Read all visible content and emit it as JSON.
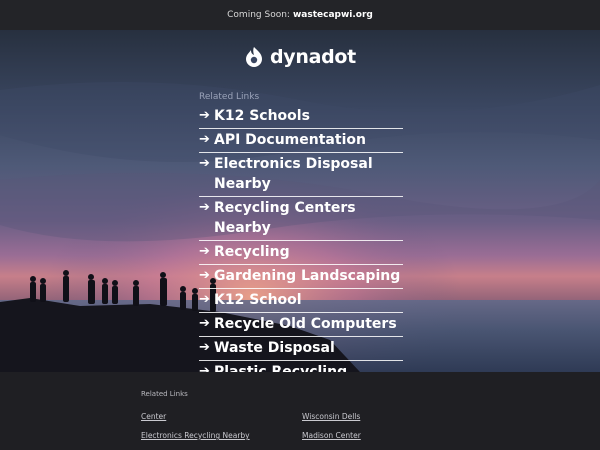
{
  "top_bar": {
    "prefix": "Coming Soon:",
    "domain": "wastecapwi.org"
  },
  "logo": {
    "text": "dynadot",
    "icon": "dynadot-flame-logo"
  },
  "related_links": {
    "heading": "Related Links",
    "arrow": "➔",
    "items": [
      {
        "label": "K12 Schools"
      },
      {
        "label": "API Documentation"
      },
      {
        "label": "Electronics Disposal Nearby"
      },
      {
        "label": "Recycling Centers Nearby"
      },
      {
        "label": "Recycling"
      },
      {
        "label": "Gardening Landscaping"
      },
      {
        "label": "K12 School"
      },
      {
        "label": "Recycle Old Computers"
      },
      {
        "label": "Waste Disposal"
      },
      {
        "label": "Plastic Recycling"
      }
    ]
  },
  "footer": {
    "heading": "Related Links",
    "links": [
      {
        "label": "Center"
      },
      {
        "label": "Wisconsin Dells"
      },
      {
        "label": "Electronics Recycling Nearby"
      },
      {
        "label": "Madison Center"
      }
    ]
  },
  "colors": {
    "top_bar_bg": "#232428",
    "footer_bg": "#1f1f23",
    "link_text": "#ffffff",
    "heading_text": "#9aa3b8"
  }
}
